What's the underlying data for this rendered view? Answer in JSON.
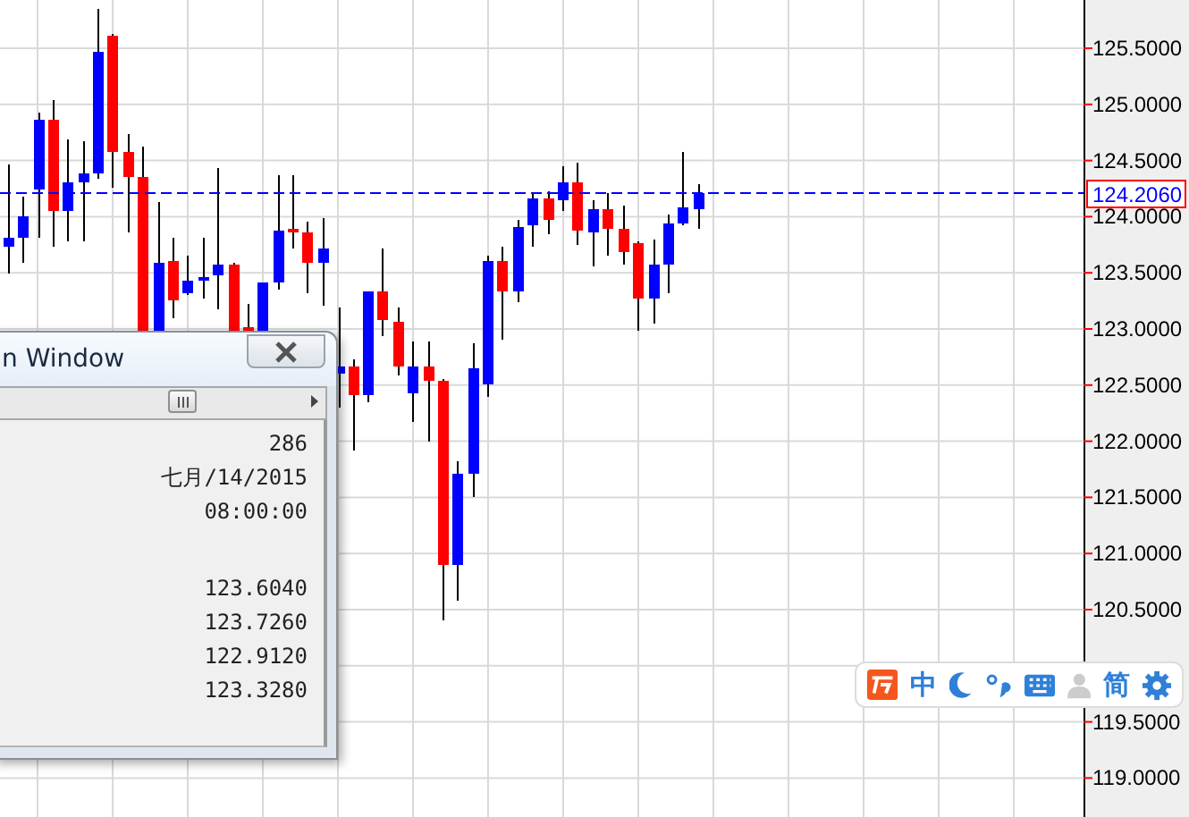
{
  "chart": {
    "axis_labels": [
      "125.5000",
      "125.0000",
      "124.5000",
      "124.0000",
      "123.5000",
      "123.0000",
      "122.5000",
      "122.0000",
      "121.5000",
      "121.0000",
      "120.5000",
      "119.5000",
      "119.0000"
    ],
    "current_price": "124.2060"
  },
  "data_window": {
    "title": "n Window",
    "info_rows": [
      "286",
      "七月/14/2015",
      "08:00:00"
    ],
    "price_rows": [
      "123.6040",
      "123.7260",
      "122.9120",
      "123.3280"
    ]
  },
  "ime_toolbar": {
    "mode": "中",
    "script": "简"
  }
}
